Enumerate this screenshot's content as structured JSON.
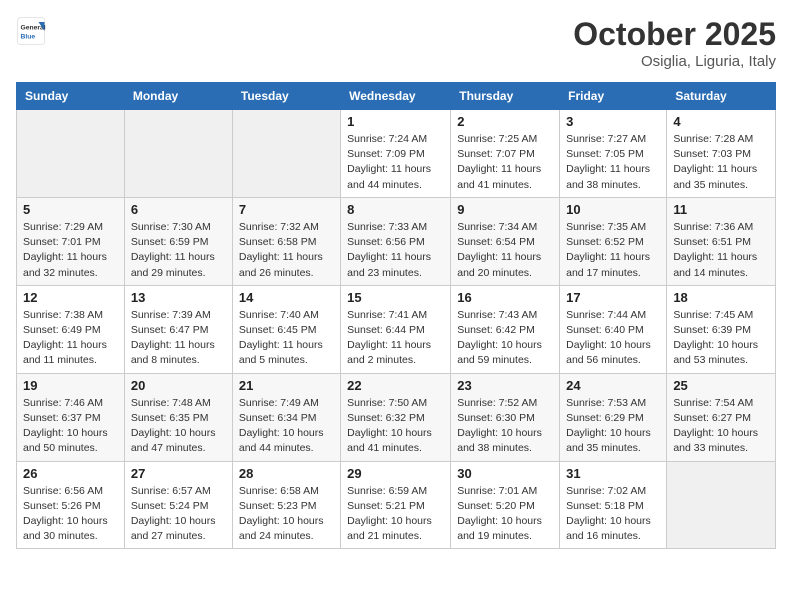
{
  "header": {
    "logo_general": "General",
    "logo_blue": "Blue",
    "month": "October 2025",
    "location": "Osiglia, Liguria, Italy"
  },
  "weekdays": [
    "Sunday",
    "Monday",
    "Tuesday",
    "Wednesday",
    "Thursday",
    "Friday",
    "Saturday"
  ],
  "weeks": [
    [
      {
        "day": "",
        "info": ""
      },
      {
        "day": "",
        "info": ""
      },
      {
        "day": "",
        "info": ""
      },
      {
        "day": "1",
        "info": "Sunrise: 7:24 AM\nSunset: 7:09 PM\nDaylight: 11 hours\nand 44 minutes."
      },
      {
        "day": "2",
        "info": "Sunrise: 7:25 AM\nSunset: 7:07 PM\nDaylight: 11 hours\nand 41 minutes."
      },
      {
        "day": "3",
        "info": "Sunrise: 7:27 AM\nSunset: 7:05 PM\nDaylight: 11 hours\nand 38 minutes."
      },
      {
        "day": "4",
        "info": "Sunrise: 7:28 AM\nSunset: 7:03 PM\nDaylight: 11 hours\nand 35 minutes."
      }
    ],
    [
      {
        "day": "5",
        "info": "Sunrise: 7:29 AM\nSunset: 7:01 PM\nDaylight: 11 hours\nand 32 minutes."
      },
      {
        "day": "6",
        "info": "Sunrise: 7:30 AM\nSunset: 6:59 PM\nDaylight: 11 hours\nand 29 minutes."
      },
      {
        "day": "7",
        "info": "Sunrise: 7:32 AM\nSunset: 6:58 PM\nDaylight: 11 hours\nand 26 minutes."
      },
      {
        "day": "8",
        "info": "Sunrise: 7:33 AM\nSunset: 6:56 PM\nDaylight: 11 hours\nand 23 minutes."
      },
      {
        "day": "9",
        "info": "Sunrise: 7:34 AM\nSunset: 6:54 PM\nDaylight: 11 hours\nand 20 minutes."
      },
      {
        "day": "10",
        "info": "Sunrise: 7:35 AM\nSunset: 6:52 PM\nDaylight: 11 hours\nand 17 minutes."
      },
      {
        "day": "11",
        "info": "Sunrise: 7:36 AM\nSunset: 6:51 PM\nDaylight: 11 hours\nand 14 minutes."
      }
    ],
    [
      {
        "day": "12",
        "info": "Sunrise: 7:38 AM\nSunset: 6:49 PM\nDaylight: 11 hours\nand 11 minutes."
      },
      {
        "day": "13",
        "info": "Sunrise: 7:39 AM\nSunset: 6:47 PM\nDaylight: 11 hours\nand 8 minutes."
      },
      {
        "day": "14",
        "info": "Sunrise: 7:40 AM\nSunset: 6:45 PM\nDaylight: 11 hours\nand 5 minutes."
      },
      {
        "day": "15",
        "info": "Sunrise: 7:41 AM\nSunset: 6:44 PM\nDaylight: 11 hours\nand 2 minutes."
      },
      {
        "day": "16",
        "info": "Sunrise: 7:43 AM\nSunset: 6:42 PM\nDaylight: 10 hours\nand 59 minutes."
      },
      {
        "day": "17",
        "info": "Sunrise: 7:44 AM\nSunset: 6:40 PM\nDaylight: 10 hours\nand 56 minutes."
      },
      {
        "day": "18",
        "info": "Sunrise: 7:45 AM\nSunset: 6:39 PM\nDaylight: 10 hours\nand 53 minutes."
      }
    ],
    [
      {
        "day": "19",
        "info": "Sunrise: 7:46 AM\nSunset: 6:37 PM\nDaylight: 10 hours\nand 50 minutes."
      },
      {
        "day": "20",
        "info": "Sunrise: 7:48 AM\nSunset: 6:35 PM\nDaylight: 10 hours\nand 47 minutes."
      },
      {
        "day": "21",
        "info": "Sunrise: 7:49 AM\nSunset: 6:34 PM\nDaylight: 10 hours\nand 44 minutes."
      },
      {
        "day": "22",
        "info": "Sunrise: 7:50 AM\nSunset: 6:32 PM\nDaylight: 10 hours\nand 41 minutes."
      },
      {
        "day": "23",
        "info": "Sunrise: 7:52 AM\nSunset: 6:30 PM\nDaylight: 10 hours\nand 38 minutes."
      },
      {
        "day": "24",
        "info": "Sunrise: 7:53 AM\nSunset: 6:29 PM\nDaylight: 10 hours\nand 35 minutes."
      },
      {
        "day": "25",
        "info": "Sunrise: 7:54 AM\nSunset: 6:27 PM\nDaylight: 10 hours\nand 33 minutes."
      }
    ],
    [
      {
        "day": "26",
        "info": "Sunrise: 6:56 AM\nSunset: 5:26 PM\nDaylight: 10 hours\nand 30 minutes."
      },
      {
        "day": "27",
        "info": "Sunrise: 6:57 AM\nSunset: 5:24 PM\nDaylight: 10 hours\nand 27 minutes."
      },
      {
        "day": "28",
        "info": "Sunrise: 6:58 AM\nSunset: 5:23 PM\nDaylight: 10 hours\nand 24 minutes."
      },
      {
        "day": "29",
        "info": "Sunrise: 6:59 AM\nSunset: 5:21 PM\nDaylight: 10 hours\nand 21 minutes."
      },
      {
        "day": "30",
        "info": "Sunrise: 7:01 AM\nSunset: 5:20 PM\nDaylight: 10 hours\nand 19 minutes."
      },
      {
        "day": "31",
        "info": "Sunrise: 7:02 AM\nSunset: 5:18 PM\nDaylight: 10 hours\nand 16 minutes."
      },
      {
        "day": "",
        "info": ""
      }
    ]
  ]
}
